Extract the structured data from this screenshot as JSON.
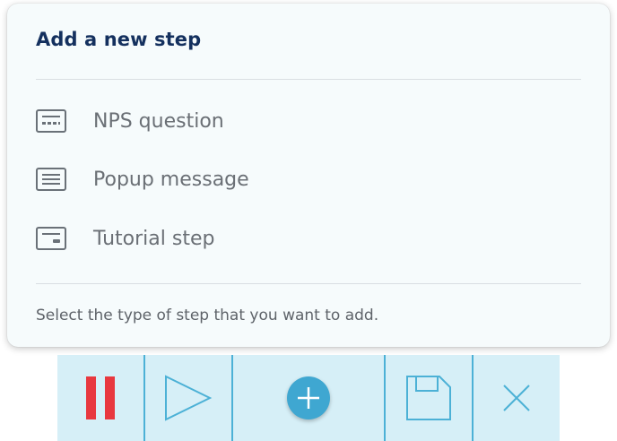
{
  "panel": {
    "title": "Add a new step",
    "options": [
      {
        "label": "NPS question",
        "icon": "nps-question-icon"
      },
      {
        "label": "Popup message",
        "icon": "popup-message-icon"
      },
      {
        "label": "Tutorial step",
        "icon": "tutorial-step-icon"
      }
    ],
    "hint": "Select the type of step that you want to add."
  },
  "toolbar": {
    "buttons": [
      {
        "name": "pause",
        "icon": "pause-icon",
        "color": "#e8383f"
      },
      {
        "name": "play",
        "icon": "play-icon",
        "color": "#4cb1d6"
      },
      {
        "name": "add",
        "icon": "plus-icon",
        "color": "#3fa7d1"
      },
      {
        "name": "save",
        "icon": "save-icon",
        "color": "#4cb1d6"
      },
      {
        "name": "close",
        "icon": "close-icon",
        "color": "#4cb1d6"
      }
    ],
    "background": "#d6eff7"
  },
  "colors": {
    "title": "#14305e",
    "text": "#6a6f75",
    "panel_bg": "#f6fbfc",
    "accent": "#4cb1d6"
  }
}
